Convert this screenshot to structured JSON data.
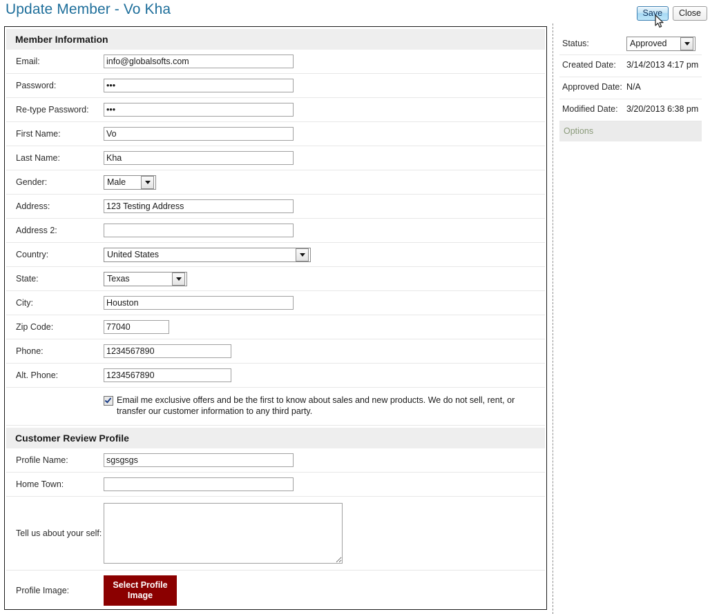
{
  "header": {
    "title": "Update Member - Vo Kha",
    "save_label": "Save",
    "close_label": "Close"
  },
  "member_information": {
    "section_title": "Member Information",
    "fields": [
      {
        "label": "Email:",
        "value": "info@globalsofts.com"
      },
      {
        "label": "Password:",
        "value": "•••"
      },
      {
        "label": "Re-type Password:",
        "value": "•••"
      },
      {
        "label": "First Name:",
        "value": "Vo"
      },
      {
        "label": "Last Name:",
        "value": "Kha"
      },
      {
        "label": "Gender:",
        "value": "Male"
      },
      {
        "label": "Address:",
        "value": "123 Testing Address"
      },
      {
        "label": "Address 2:",
        "value": ""
      },
      {
        "label": "Country:",
        "value": "United States"
      },
      {
        "label": "State:",
        "value": "Texas"
      },
      {
        "label": "City:",
        "value": "Houston"
      },
      {
        "label": "Zip Code:",
        "value": "77040"
      },
      {
        "label": "Phone:",
        "value": "1234567890"
      },
      {
        "label": "Alt. Phone:",
        "value": "1234567890"
      }
    ],
    "newsletter": {
      "checked": true,
      "text": "Email me exclusive offers and be the first to know about sales and new products. We do not sell, rent, or transfer our customer information to any third party."
    }
  },
  "customer_review_profile": {
    "section_title": "Customer Review Profile",
    "profile_name_label": "Profile Name:",
    "profile_name_value": "sgsgsgs",
    "home_town_label": "Home Town:",
    "home_town_value": "",
    "about_label": "Tell us about your self:",
    "about_value": "",
    "profile_image_label": "Profile Image:",
    "select_image_button": "Select Profile Image"
  },
  "sidebar": {
    "status_label": "Status:",
    "status_value": "Approved",
    "created_date_label": "Created Date:",
    "created_date_value": "3/14/2013 4:17 pm",
    "approved_date_label": "Approved Date:",
    "approved_date_value": "N/A",
    "modified_date_label": "Modified Date:",
    "modified_date_value": "3/20/2013 6:38 pm",
    "options_label": "Options"
  },
  "colors": {
    "title": "#1f6f9b",
    "section_header_bg": "#eeeeee",
    "primary_button": "#8b0000",
    "options_text": "#8a9a7a"
  }
}
